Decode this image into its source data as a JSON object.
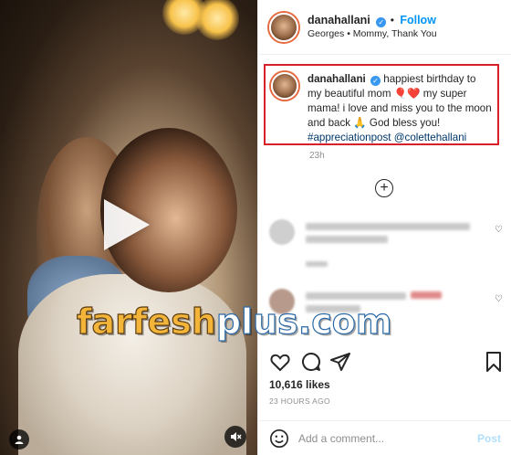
{
  "post": {
    "media_alt": "Video of two women hugging",
    "watermark_main": "farfesh",
    "watermark_plus": "plus.com"
  },
  "header": {
    "username": "danahallani",
    "follow_label": "Follow",
    "separator": "•",
    "location": "Georges • Mommy, Thank You"
  },
  "caption": {
    "username": "danahallani",
    "text_1": "happiest birthday to my beautiful mom 🎈❤️ my super mama! i love and miss you to the moon and back 🙏 God bless you!",
    "hashtag": "#appreciationpost",
    "mention": "@colettehallani",
    "time": "23h"
  },
  "stats": {
    "likes": "10,616 likes",
    "ago": "23 HOURS AGO"
  },
  "comment_box": {
    "placeholder": "Add a comment...",
    "post_label": "Post"
  },
  "icons": {
    "verified": "verified-badge-icon",
    "load_more": "plus-circle-icon",
    "like": "heart-icon",
    "comment": "comment-icon",
    "share": "share-icon",
    "save": "bookmark-icon",
    "emoji": "smiley-icon",
    "play": "play-icon",
    "tag": "user-tag-icon",
    "mute": "mute-icon"
  },
  "colors": {
    "follow": "#0095f6",
    "highlight_border": "#d6212a",
    "hashtag": "#00376b"
  }
}
